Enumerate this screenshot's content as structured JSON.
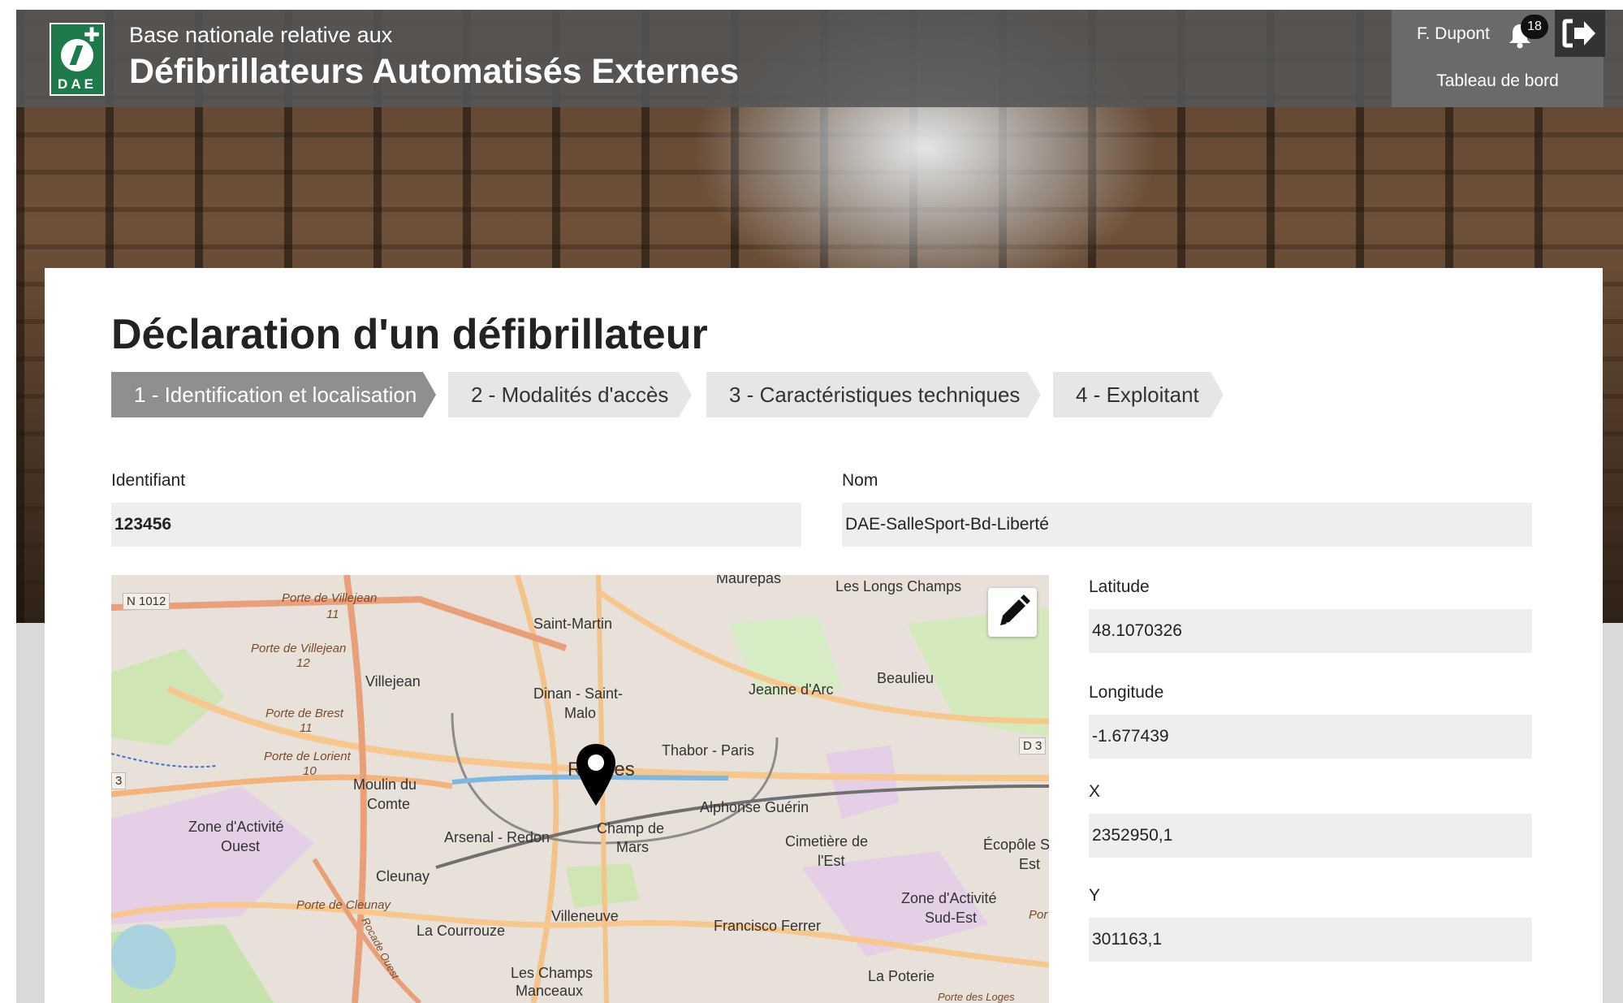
{
  "header": {
    "logo_text": "DAE",
    "subtitle": "Base nationale relative aux",
    "title": "Défibrillateurs Automatisés Externes",
    "user_name": "F. Dupont",
    "notification_count": "18",
    "dashboard_link": "Tableau de bord",
    "icons": [
      "bell-icon",
      "logout-icon"
    ]
  },
  "page": {
    "title": "Déclaration d'un défibrillateur",
    "steps": [
      {
        "label": "1 - Identification et localisation",
        "active": true
      },
      {
        "label": "2 - Modalités d'accès",
        "active": false
      },
      {
        "label": "3 - Caractéristiques techniques",
        "active": false
      },
      {
        "label": "4 - Exploitant",
        "active": false
      }
    ]
  },
  "form": {
    "identifiant_label": "Identifiant",
    "identifiant_value": "123456",
    "nom_label": "Nom",
    "nom_value": "DAE-SalleSport-Bd-Liberté",
    "latitude_label": "Latitude",
    "latitude_value": "48.1070326",
    "longitude_label": "Longitude",
    "longitude_value": "-1.677439",
    "x_label": "X",
    "x_value": "2352950,1",
    "y_label": "Y",
    "y_value": "301163,1"
  },
  "map": {
    "edit_icon": "pencil-icon",
    "marker_icon": "map-marker-icon",
    "labels": [
      "N 1012",
      "Porte de Villejean",
      "11",
      "Porte de Villejean",
      "12",
      "Saint-Martin",
      "Maurepas",
      "Les Longs Champs",
      "Beaulieu",
      "Villejean",
      "Jeanne d'Arc",
      "Dinan - Saint-",
      "Malo",
      "Porte de Brest",
      "11",
      "Thabor - Paris",
      "D 3",
      "Porte de Lorient",
      "10",
      "3",
      "Moulin du",
      "Comte",
      "Rennes",
      "Alphonse Guérin",
      "Zone d'Activité",
      "Ouest",
      "Arsenal - Redon",
      "Champ de",
      "Mars",
      "Cimetière de",
      "l'Est",
      "Écopôle S",
      "Est",
      "Cleunay",
      "Porte de Cleunay",
      "Zone d'Activité",
      "Sud-Est",
      "Villeneuve",
      "La Courrouze",
      "Rocade Ouest",
      "Francisco Ferrer",
      "Les Champs",
      "Manceaux",
      "La Poterie",
      "Porte des Loges",
      "Por"
    ]
  }
}
